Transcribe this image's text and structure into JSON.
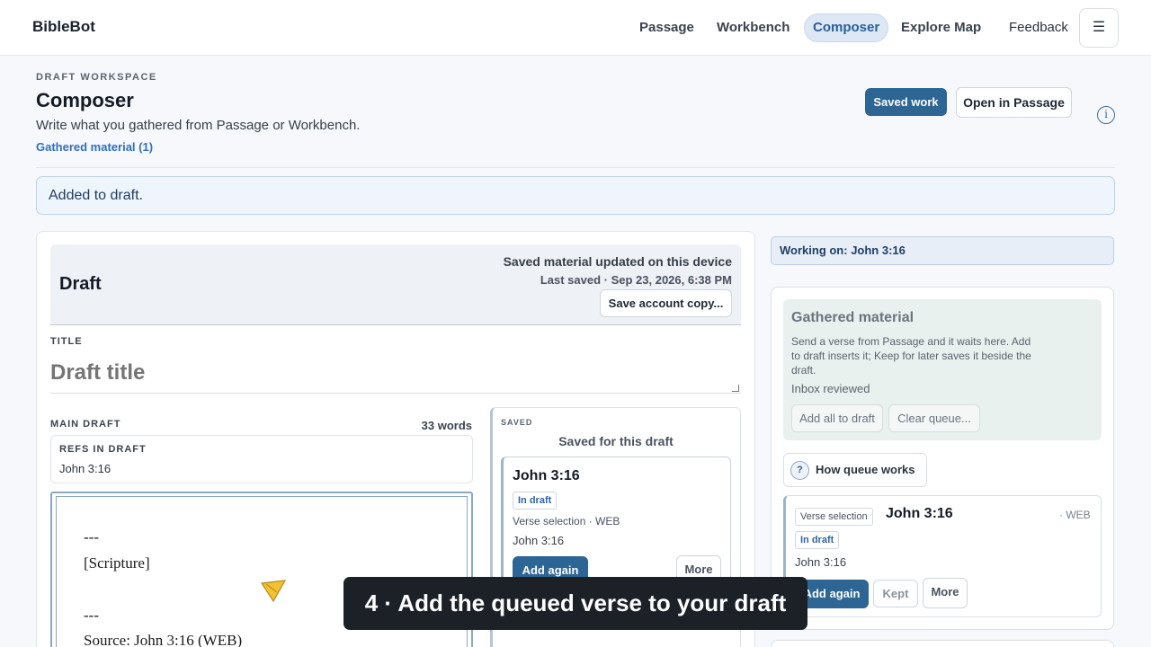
{
  "nav": {
    "brand": "BibleBot",
    "links": [
      "Passage",
      "Workbench",
      "Composer",
      "Explore Map"
    ],
    "active": "Composer",
    "feedback": "Feedback",
    "menu_icon": "hamburger-icon"
  },
  "header": {
    "eyebrow": "DRAFT WORKSPACE",
    "title": "Composer",
    "subtitle": "Write what you gathered from Passage or Workbench.",
    "gathered_link": "Gathered material (1)",
    "saved_work_button": "Saved work",
    "open_passage_button": "Open in Passage",
    "info_icon": "info-icon"
  },
  "toast": "Added to draft.",
  "draft": {
    "heading": "Draft",
    "saved_status": "Saved material updated on this device",
    "last_saved": "Last saved · Sep 23, 2026, 6:38 PM",
    "save_account_button": "Save account copy...",
    "title_label": "TITLE",
    "title_placeholder": "Draft title",
    "main_label": "MAIN DRAFT",
    "word_count": "33 words",
    "refs_label": "REFS IN DRAFT",
    "refs_value": "John 3:16",
    "editor_lines": [
      "---",
      "[Scripture]",
      "---",
      "Source: John 3:16 (WEB)"
    ]
  },
  "saved_panel": {
    "eyebrow": "SAVED",
    "title": "Saved for this draft",
    "card": {
      "ref": "John 3:16",
      "badge": "In draft",
      "meta": "Verse selection · WEB",
      "ref_small": "John 3:16",
      "add_again": "Add again",
      "more": "More"
    }
  },
  "right": {
    "working_on": "Working on: John 3:16",
    "gathered_title": "Gathered material",
    "gathered_desc": "Send a verse from Passage and it waits here. Add to draft inserts it; Keep for later saves it beside the draft.",
    "inbox_reviewed": "Inbox reviewed",
    "add_all": "Add all to draft",
    "clear_queue": "Clear queue...",
    "how_queue": "How queue works",
    "how_icon": "?",
    "queue_card": {
      "type": "Verse selection",
      "ref": "John 3:16",
      "translation": "· WEB",
      "badge": "In draft",
      "ref_small": "John 3:16",
      "add_again": "Add again",
      "kept": "Kept",
      "more": "More"
    }
  },
  "caption": "4 · Add the queued verse to your draft",
  "colors": {
    "primary": "#2d6595",
    "accent_link": "#2f6fbd",
    "caption_bg": "#1c2128",
    "cursor": "#f2c230"
  }
}
